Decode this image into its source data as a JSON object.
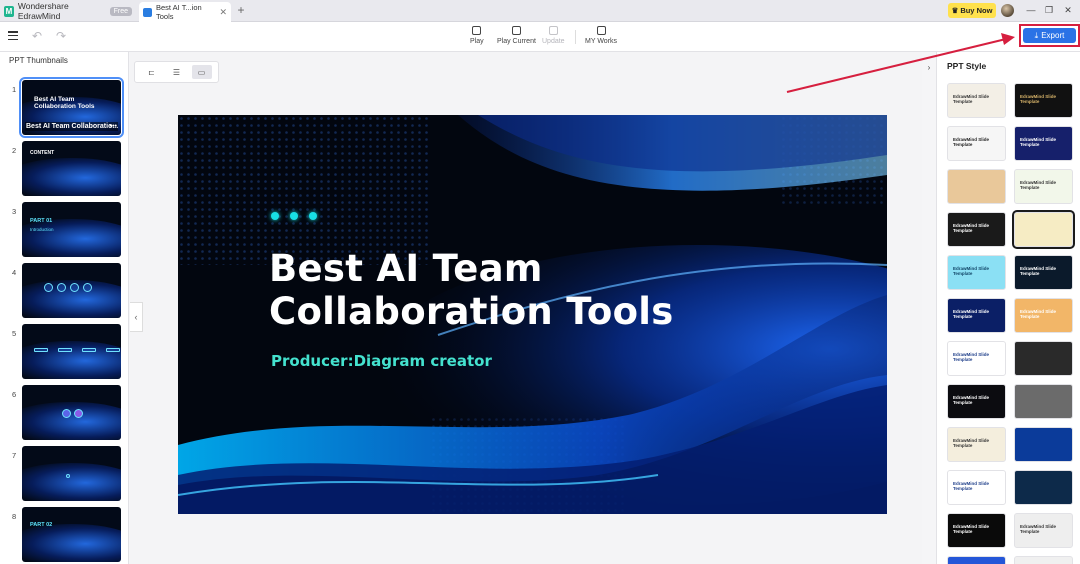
{
  "window": {
    "app_name": "Wondershare EdrawMind",
    "free_badge": "Free",
    "doc_tab": "Best AI T...ion Tools",
    "buy_now": "Buy Now"
  },
  "toolbar": {
    "play": "Play",
    "play_current": "Play Current",
    "update": "Update",
    "my_works": "MY Works",
    "export": "Export"
  },
  "left_panel": {
    "title": "PPT Thumbnails",
    "thumbnails": [
      {
        "num": "1",
        "title": "Best AI Team Collaboration Tools",
        "subtitle": "Best AI Team Collaboratio..."
      },
      {
        "num": "2",
        "title": "CONTENT"
      },
      {
        "num": "3",
        "title": "PART 01",
        "subtitle": "Introduction"
      },
      {
        "num": "4"
      },
      {
        "num": "5"
      },
      {
        "num": "6"
      },
      {
        "num": "7"
      },
      {
        "num": "8",
        "title": "PART 02"
      }
    ]
  },
  "slide": {
    "title": "Best AI Team Collaboration Tools",
    "producer": "Producer:Diagram creator"
  },
  "right_panel": {
    "title": "PPT Style",
    "styles": [
      {
        "label": "EdrawMind Slide Template",
        "bg": "#f3efe6",
        "fg": "#333333"
      },
      {
        "label": "EdrawMind Slide Template",
        "bg": "#111111",
        "fg": "#d8b46a"
      },
      {
        "label": "EdrawMind Slide Template",
        "bg": "#f6f6f6",
        "fg": "#222222"
      },
      {
        "label": "EdrawMind Slide Template",
        "bg": "#16206b",
        "fg": "#ffffff"
      },
      {
        "label": "",
        "bg": "#e9c89a",
        "fg": "#333333"
      },
      {
        "label": "EdrawMind Slide Template",
        "bg": "#f2f7ea",
        "fg": "#333333"
      },
      {
        "label": "EdrawMind Slide Template",
        "bg": "#1a1a1a",
        "fg": "#ffffff"
      },
      {
        "label": "",
        "bg": "#f6ecc4",
        "fg": "#333333"
      },
      {
        "label": "EdrawMind Slide Template",
        "bg": "#8be0f4",
        "fg": "#114466"
      },
      {
        "label": "EdrawMind Slide Template",
        "bg": "#0b1a2b",
        "fg": "#ffffff"
      },
      {
        "label": "EdrawMind Slide Template",
        "bg": "#0b1f66",
        "fg": "#ffffff"
      },
      {
        "label": "EdrawMind Slide Template",
        "bg": "#f2b668",
        "fg": "#ffffff"
      },
      {
        "label": "EdrawMind Slide Template",
        "bg": "#ffffff",
        "fg": "#1f3f8a"
      },
      {
        "label": "",
        "bg": "#2a2a2a",
        "fg": "#ffffff"
      },
      {
        "label": "EdrawMind Slide Template",
        "bg": "#0c0c10",
        "fg": "#ffffff"
      },
      {
        "label": "",
        "bg": "#6b6b6b",
        "fg": "#ffffff"
      },
      {
        "label": "EdrawMind Slide Template",
        "bg": "#f4eedd",
        "fg": "#333333"
      },
      {
        "label": "",
        "bg": "#0b3b9a",
        "fg": "#ffffff"
      },
      {
        "label": "EdrawMind Slide Template",
        "bg": "#ffffff",
        "fg": "#1f3f8a"
      },
      {
        "label": "",
        "bg": "#0d2a4a",
        "fg": "#ffffff"
      },
      {
        "label": "EdrawMind Slide Template",
        "bg": "#0a0a0a",
        "fg": "#ffffff"
      },
      {
        "label": "EdrawMind Slide Template",
        "bg": "#eeeeee",
        "fg": "#333333"
      },
      {
        "label": "",
        "bg": "#2456d8",
        "fg": "#ffffff"
      },
      {
        "label": "",
        "bg": "#f0f0f0",
        "fg": "#333333"
      }
    ]
  },
  "colors": {
    "accent": "#2a72e6",
    "highlight_frame": "#d61f3f",
    "slide_title_accent": "#44e2cf"
  }
}
